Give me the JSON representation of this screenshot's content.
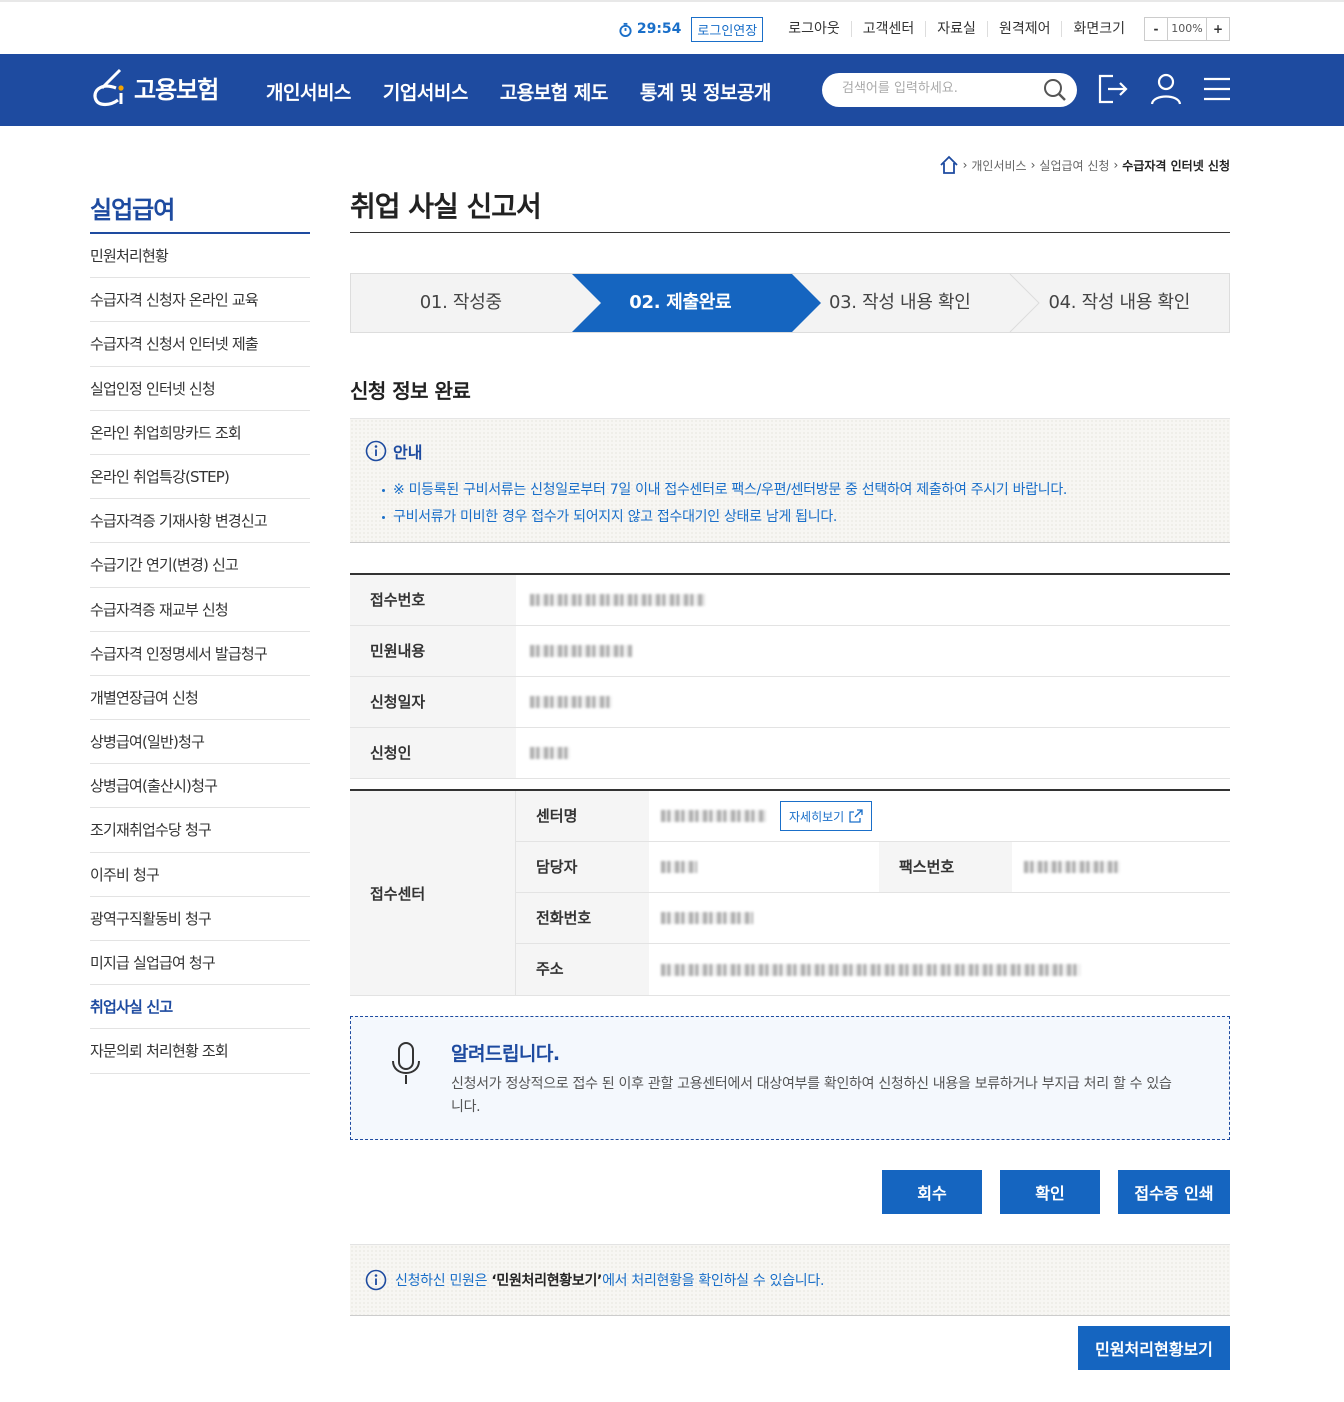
{
  "util": {
    "timer": "29:54",
    "extend_label": "로그인연장",
    "links": [
      "로그아웃",
      "고객센터",
      "자료실",
      "원격제어",
      "화면크기"
    ],
    "zoom_minus": "-",
    "zoom_value": "100%",
    "zoom_plus": "+"
  },
  "header": {
    "logo_text": "고용보험",
    "menu": [
      "개인서비스",
      "기업서비스",
      "고용보험 제도",
      "통계 및 정보공개"
    ],
    "search_placeholder": "검색어를 입력하세요."
  },
  "breadcrumb": {
    "items": [
      "개인서비스",
      "실업급여 신청"
    ],
    "current": "수급자격 인터넷 신청"
  },
  "sidebar": {
    "title": "실업급여",
    "items": [
      "민원처리현황",
      "수급자격 신청자 온라인 교육",
      "수급자격 신청서 인터넷 제출",
      "실업인정 인터넷 신청",
      "온라인 취업희망카드 조회",
      "온라인 취업특강(STEP)",
      "수급자격증 기재사항 변경신고",
      "수급기간 연기(변경) 신고",
      "수급자격증 재교부 신청",
      "수급자격 인정명세서 발급청구",
      "개별연장급여 신청",
      "상병급여(일반)청구",
      "상병급여(출산시)청구",
      "조기재취업수당 청구",
      "이주비 청구",
      "광역구직활동비 청구",
      "미지급 실업급여 청구",
      "취업사실 신고",
      "자문의뢰 처리현황 조회"
    ],
    "active_index": 17
  },
  "page": {
    "title": "취업 사실 신고서",
    "steps": [
      "01. 작성중",
      "02. 제출완료",
      "03. 작성 내용 확인",
      "04. 작성 내용 확인"
    ],
    "active_step": 1,
    "section_title": "신청 정보 완료",
    "notice": {
      "title": "안내",
      "items": [
        "※ 미등록된 구비서류는 신청일로부터 7일 이내 접수센터로 팩스/우편/센터방문 중 선택하여 제출하여 주시기 바랍니다.",
        "구비서류가 미비한 경우 접수가 되어지지 않고 접수대기인 상태로 남게 됩니다."
      ]
    },
    "info_table": {
      "rows": [
        {
          "label": "접수번호"
        },
        {
          "label": "민원내용"
        },
        {
          "label": "신청일자"
        },
        {
          "label": "신청인"
        }
      ]
    },
    "center_table": {
      "head": "접수센터",
      "center_name_label": "센터명",
      "detail_button": "자세히보기",
      "manager_label": "담당자",
      "fax_label": "팩스번호",
      "phone_label": "전화번호",
      "address_label": "주소"
    },
    "alert": {
      "title": "알려드립니다.",
      "text": "신청서가 정상적으로 접수 된 이후 관할 고용센터에서 대상여부를 확인하여 신청하신 내용을 보류하거나 부지급 처리 할 수 있습니다."
    },
    "buttons": {
      "withdraw": "회수",
      "confirm": "확인",
      "print_receipt": "접수증 인쇄"
    },
    "bottom_note": {
      "before": "신청하신 민원은 ",
      "bold": "‘민원처리현황보기’",
      "after": "에서 처리현황을 확인하실 수 있습니다."
    },
    "status_button": "민원처리현황보기"
  },
  "colors": {
    "brand_navy": "#1e4ba0",
    "accent_blue": "#1565c0",
    "link_blue": "#1a6fc9"
  }
}
